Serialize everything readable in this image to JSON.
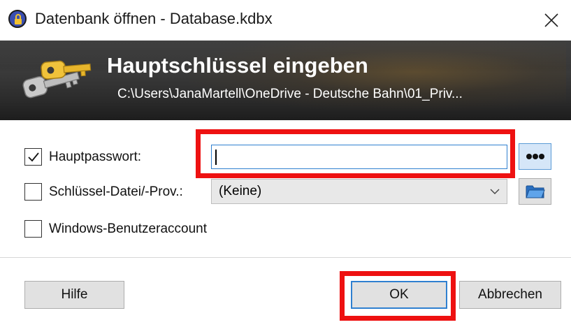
{
  "window": {
    "title": "Datenbank öffnen - Database.kdbx",
    "close_glyph": "✕",
    "app_icon": "keepass-lock-icon"
  },
  "banner": {
    "title": "Hauptschlüssel eingeben",
    "path": "C:\\Users\\JanaMartell\\OneDrive - Deutsche Bahn\\01_Priv...",
    "icon": "keys-icon"
  },
  "form": {
    "master_password": {
      "label": "Hauptpasswort:",
      "checked": true,
      "value": "",
      "reveal_button_icon": "dots-icon"
    },
    "key_file": {
      "label": "Schlüssel-Datei/-Prov.:",
      "checked": false,
      "selected": "(Keine)",
      "browse_button_icon": "folder-icon"
    },
    "windows_account": {
      "label": "Windows-Benutzeraccount",
      "checked": false
    }
  },
  "buttons": {
    "help": "Hilfe",
    "ok": "OK",
    "cancel": "Abbrechen"
  },
  "colors": {
    "highlight_red": "#ee1111",
    "focus_blue": "#2f80d0",
    "banner_dark": "#2b2b2b"
  }
}
